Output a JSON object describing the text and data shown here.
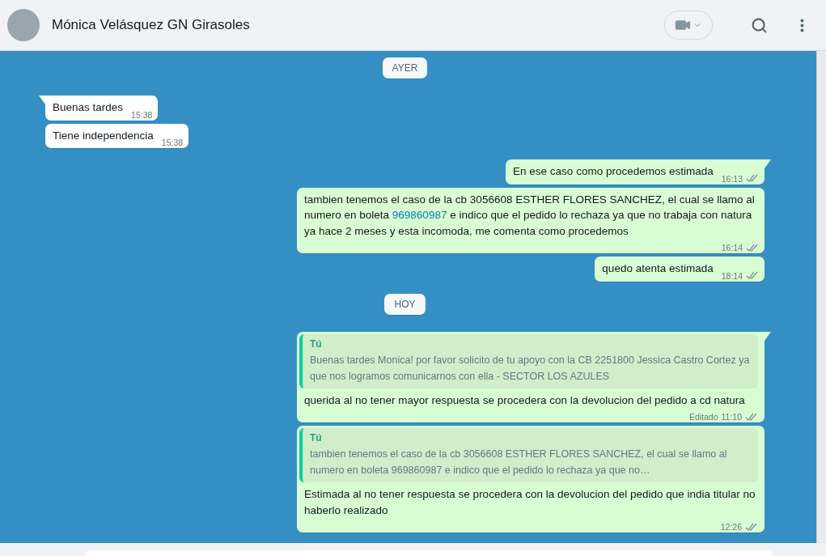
{
  "header": {
    "contact_name": "Mónica Velásquez GN Girasoles"
  },
  "timeline": [
    {
      "kind": "day",
      "label": "AYER"
    },
    {
      "kind": "message",
      "outgoing": false,
      "tail": true,
      "segments": [
        {
          "kind": "text",
          "text": "Buenas tardes"
        }
      ],
      "time": "15:38"
    },
    {
      "kind": "message",
      "outgoing": false,
      "tail": false,
      "segments": [
        {
          "kind": "text",
          "text": "Tiene independencia"
        }
      ],
      "time": "15:38"
    },
    {
      "kind": "message",
      "outgoing": true,
      "tail": true,
      "segments": [
        {
          "kind": "text",
          "text": "En ese caso como procedemos estimada"
        }
      ],
      "time": "16:13",
      "read": false
    },
    {
      "kind": "message",
      "outgoing": true,
      "tail": false,
      "segments": [
        {
          "kind": "text",
          "text": "tambien tenemos el caso de la cb 3056608 ESTHER FLORES SANCHEZ, el cual se llamo al numero en boleta "
        },
        {
          "kind": "link",
          "text": "969860987"
        },
        {
          "kind": "text",
          "text": " e indico que el pedido lo rechaza ya que no trabaja con natura ya hace 2 meses y esta incomoda, me comenta como procedemos"
        }
      ],
      "time": "16:14",
      "read": false
    },
    {
      "kind": "message",
      "outgoing": true,
      "tail": false,
      "segments": [
        {
          "kind": "text",
          "text": "quedo atenta estimada"
        }
      ],
      "time": "18:14",
      "read": false
    },
    {
      "kind": "day",
      "label": "HOY"
    },
    {
      "kind": "message",
      "outgoing": true,
      "tail": true,
      "quote": {
        "author": "Tú",
        "text": "Buenas tardes Monica! por favor solicito de tu apoyo con la CB 2251800 Jessica Castro Cortez ya que nos logramos comunicarnos con ella - SECTOR LOS AZULES"
      },
      "segments": [
        {
          "kind": "text",
          "text": "querida al no tener mayor respuesta se procedera con la devolucion del pedido a cd natura"
        }
      ],
      "edited_label": "Editado",
      "time": "11:10",
      "read": false
    },
    {
      "kind": "message",
      "outgoing": true,
      "tail": false,
      "quote": {
        "author": "Tú",
        "text": "tambien tenemos el caso de la cb 3056608 ESTHER FLORES SANCHEZ, el cual se llamo al numero en boleta 969860987 e indico que el pedido lo rechaza ya que no…"
      },
      "segments": [
        {
          "kind": "text",
          "text": "Estimada al no tener respuesta se procedera con la devolucion del pedido que india titular no haberlo realizado"
        }
      ],
      "time": "12:26",
      "read": false
    }
  ]
}
